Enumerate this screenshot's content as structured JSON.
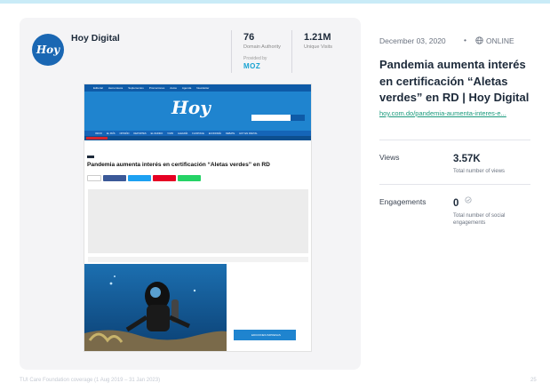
{
  "publication": {
    "logo_text": "Hoy",
    "name": "Hoy Digital",
    "domain_authority": "76",
    "domain_authority_label": "Domain Authority",
    "provided_by": "Provided by",
    "provider": "MOZ",
    "unique_visits": "1.21M",
    "unique_visits_label": "Unique Visits"
  },
  "screenshot": {
    "nav": [
      "Editorial",
      "Hemeroteca",
      "Suplementos",
      "Promociones",
      "Autos",
      "Agenda",
      "Newsletter"
    ],
    "menu": [
      "INICIO",
      "EL PAÍS",
      "OPINIÓN",
      "DEPORTES",
      "EL MUNDO",
      "VIVIR",
      "ALEGRÍA",
      "FLORTACE",
      "ECONOMÍA",
      "DEBATE",
      "HOY EN DIGITAL"
    ],
    "masthead": "Hoy",
    "article_title": "Pandemia aumenta interés en certificación “Aletas verdes” en RD",
    "ediciones": "EDICIONES IMPRESAS"
  },
  "article": {
    "date": "December 03, 2020",
    "separator": "•",
    "status": "ONLINE",
    "title": "Pandemia aumenta interés en certificación “Aletas verdes” en RD | Hoy Digital",
    "link": "hoy.com.do/pandemia-aumenta-interes-e..."
  },
  "metrics": {
    "views_label": "Views",
    "views_value": "3.57K",
    "views_sub": "Total number of views",
    "engagements_label": "Engagements",
    "engagements_value": "0",
    "engagements_sub": "Total number of social engagements"
  },
  "footer": {
    "text": "TUI Care Foundation coverage (1 Aug 2019 – 31 Jan 2023)",
    "page": "25"
  },
  "colors": {
    "background": "#d9f3fc",
    "hoy_blue": "#1a67b3",
    "link_green": "#1a9a7c",
    "moz_blue": "#19a3d2"
  }
}
